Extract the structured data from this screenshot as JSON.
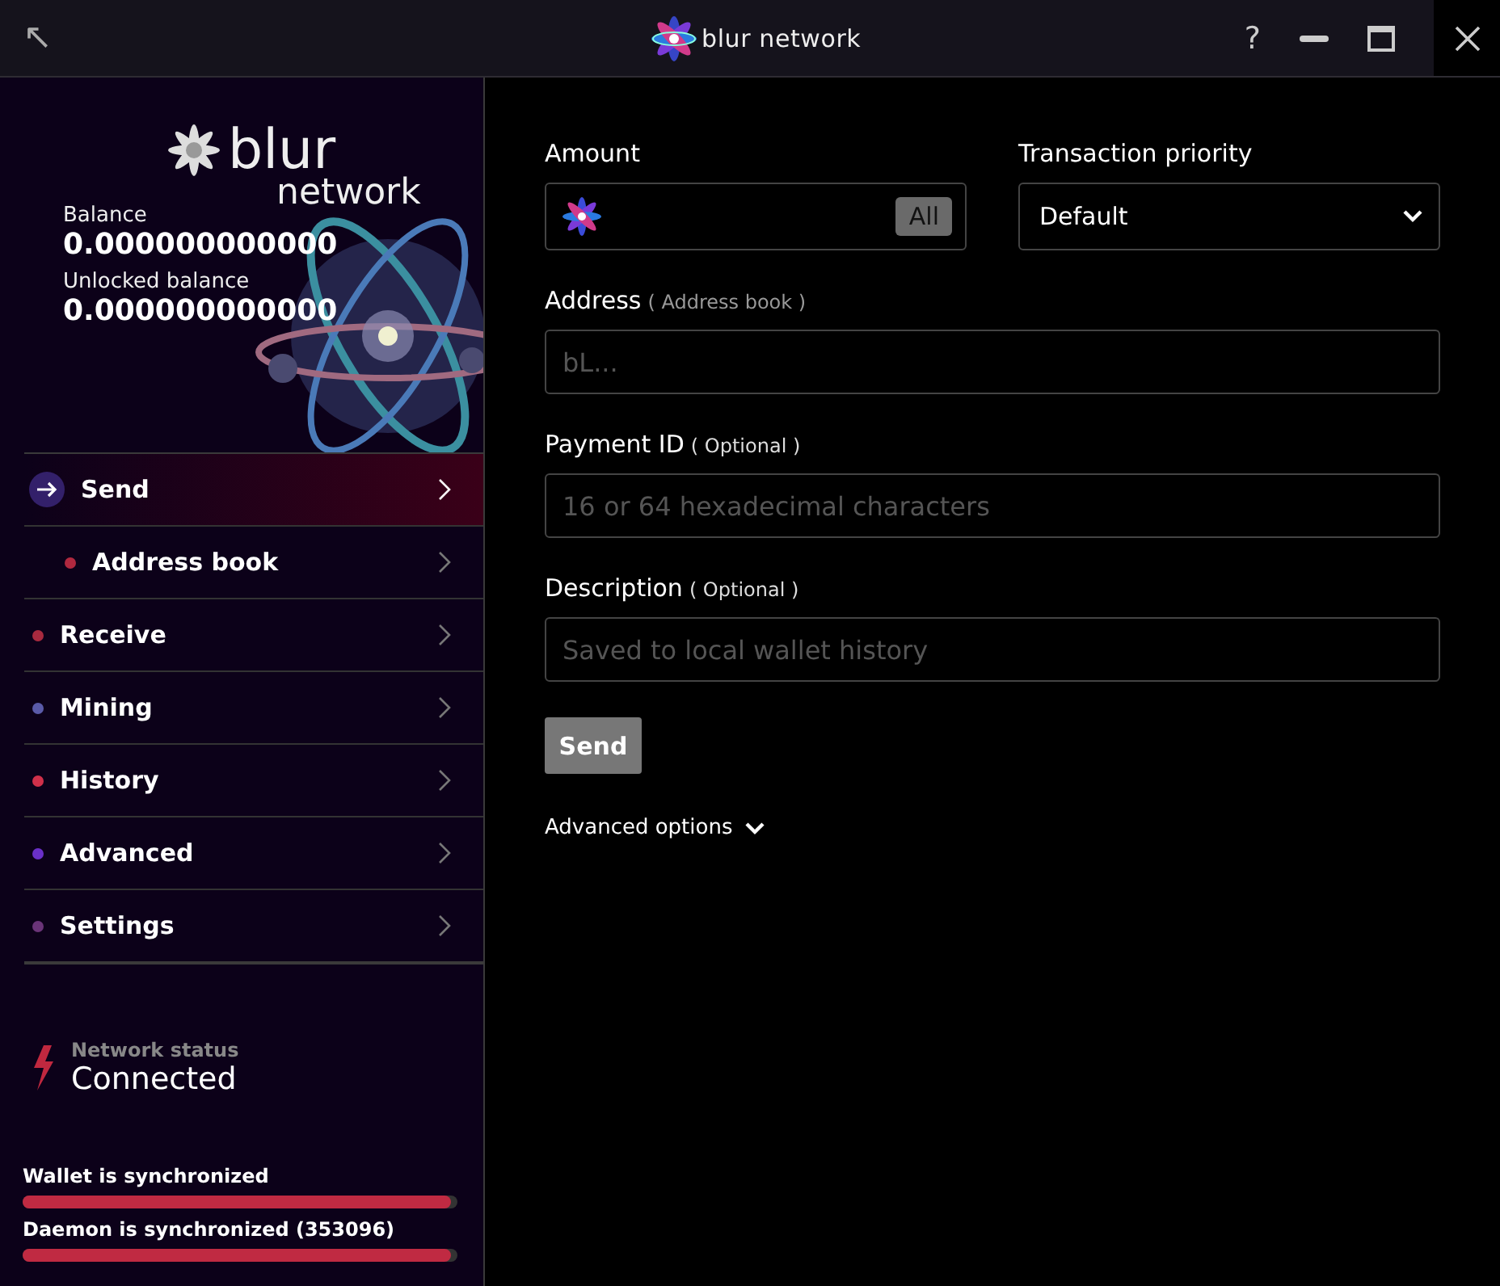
{
  "titlebar": {
    "back": "↖",
    "logo": "blur network",
    "help": "?"
  },
  "sidebar": {
    "logo_top": "blur",
    "logo_bottom": "network",
    "balance_label": "Balance",
    "balance": "0.000000000000",
    "unlocked_label": "Unlocked balance",
    "unlocked": "0.000000000000",
    "nav": [
      {
        "label": "Send",
        "kind": "icon",
        "selected": true,
        "children": [
          {
            "label": "Address book",
            "kind": "dot",
            "color": "#b0283f",
            "selected": false
          }
        ]
      },
      {
        "label": "Receive",
        "kind": "dot",
        "color": "#a82a3f",
        "selected": false
      },
      {
        "label": "Mining",
        "kind": "dot",
        "color": "#5a5aa8",
        "selected": false
      },
      {
        "label": "History",
        "kind": "dot",
        "color": "#d0304a",
        "selected": false
      },
      {
        "label": "Advanced",
        "kind": "dot",
        "color": "#6a30c8",
        "selected": false
      },
      {
        "label": "Settings",
        "kind": "dot",
        "color": "#6a3478",
        "selected": false
      }
    ],
    "network_label": "Network status",
    "network_status": "Connected",
    "sync": [
      {
        "label": "Wallet is synchronized",
        "level": 0.985
      },
      {
        "label": "Daemon is synchronized (353096)",
        "level": 0.985
      }
    ]
  },
  "form": {
    "amount_label": "Amount",
    "all_button": "All",
    "priority_label": "Transaction priority",
    "priority_value": "Default",
    "address_label": "Address",
    "address_link": "( Address book )",
    "address_placeholder": "bL...",
    "payment_label": "Payment ID",
    "payment_note": "( Optional )",
    "payment_placeholder": "16 or 64 hexadecimal characters",
    "description_label": "Description",
    "description_note": "( Optional )",
    "description_placeholder": "Saved to local wallet history",
    "send_button": "Send",
    "advanced": "Advanced options",
    "advanced_expanded": false
  }
}
